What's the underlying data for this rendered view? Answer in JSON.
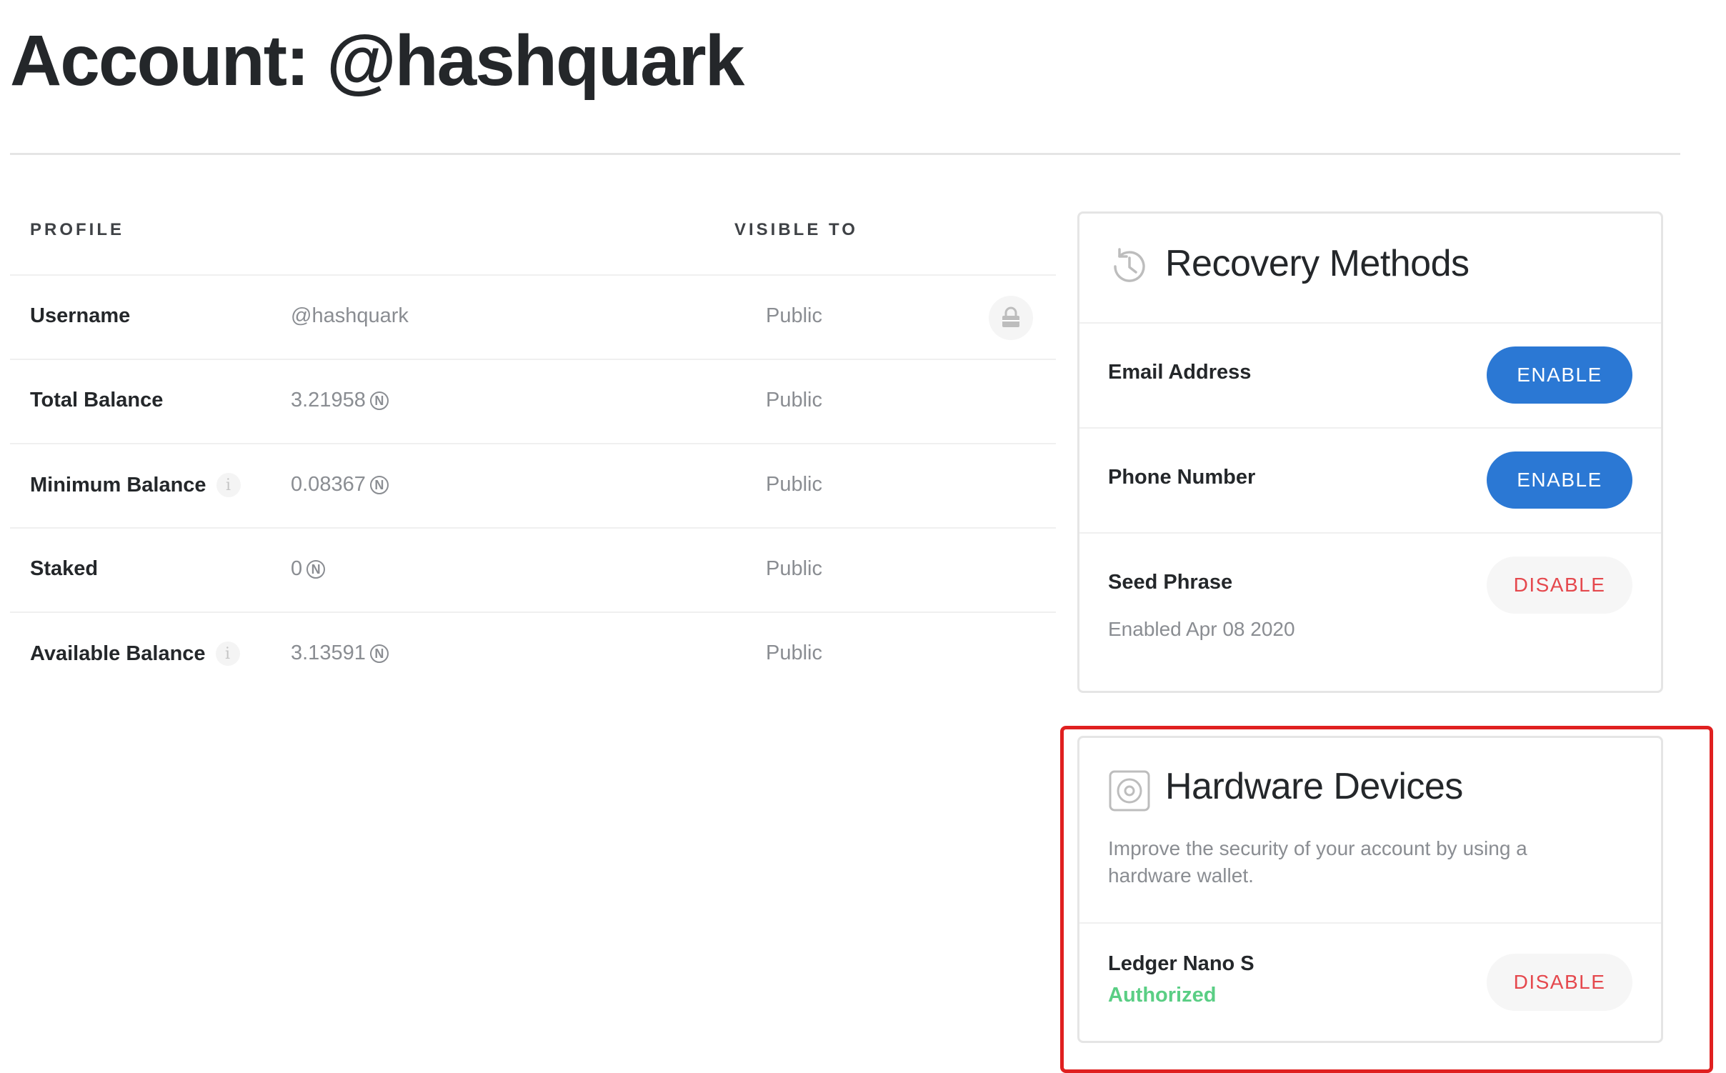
{
  "page": {
    "title": "Account: @hashquark"
  },
  "profile": {
    "header_profile": "PROFILE",
    "header_visible_to": "VISIBLE TO",
    "rows": [
      {
        "label": "Username",
        "value": "@hashquark",
        "visibility": "Public",
        "has_info": false,
        "near": false
      },
      {
        "label": "Total Balance",
        "value": "3.21958",
        "visibility": "Public",
        "has_info": false,
        "near": true
      },
      {
        "label": "Minimum Balance",
        "value": "0.08367",
        "visibility": "Public",
        "has_info": true,
        "near": true
      },
      {
        "label": "Staked",
        "value": "0",
        "visibility": "Public",
        "has_info": false,
        "near": true
      },
      {
        "label": "Available Balance",
        "value": "3.13591",
        "visibility": "Public",
        "has_info": true,
        "near": true
      }
    ],
    "info_glyph": "i",
    "near_glyph": "N",
    "lock_icon": "lock-icon"
  },
  "recovery": {
    "title": "Recovery Methods",
    "icon": "history-icon",
    "methods": [
      {
        "label": "Email Address",
        "button": "ENABLE"
      },
      {
        "label": "Phone Number",
        "button": "ENABLE"
      },
      {
        "label": "Seed Phrase",
        "button": "DISABLE",
        "enabled_date": "Enabled Apr 08 2020"
      }
    ]
  },
  "hardware": {
    "title": "Hardware Devices",
    "icon": "hardware-device-icon",
    "description": "Improve the security of your account by using a hardware wallet.",
    "device": {
      "name": "Ledger Nano S",
      "status": "Authorized",
      "button": "DISABLE"
    }
  },
  "colors": {
    "enable_button": "#2b78d4",
    "disable_text": "#e5484d",
    "authorized": "#5ace84",
    "highlight": "#e02020"
  }
}
